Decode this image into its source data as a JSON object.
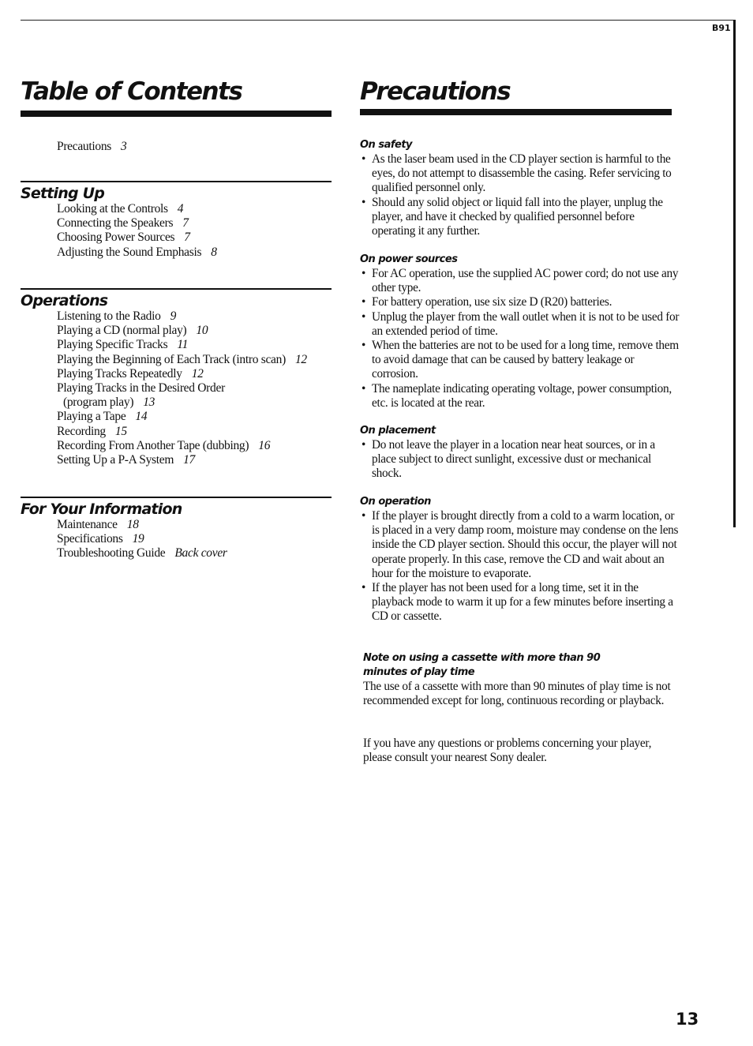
{
  "model_code": "B91",
  "toc": {
    "title": "Table of Contents",
    "intro": [
      {
        "label": "Precautions",
        "page": "3"
      }
    ],
    "sections": [
      {
        "title": "Setting Up",
        "items": [
          {
            "label": "Looking at the Controls",
            "page": "4"
          },
          {
            "label": "Connecting the Speakers",
            "page": "7"
          },
          {
            "label": "Choosing Power Sources",
            "page": "7"
          },
          {
            "label": "Adjusting the Sound Emphasis",
            "page": "8"
          }
        ]
      },
      {
        "title": "Operations",
        "items": [
          {
            "label": "Listening to the Radio",
            "page": "9"
          },
          {
            "label": "Playing a CD (normal play)",
            "page": "10"
          },
          {
            "label": "Playing Specific Tracks",
            "page": "11"
          },
          {
            "label": "Playing the Beginning of Each Track (intro scan)",
            "page": "12"
          },
          {
            "label": "Playing Tracks Repeatedly",
            "page": "12"
          },
          {
            "label": "Playing Tracks in the Desired Order",
            "page": ""
          },
          {
            "label": "(program play)",
            "page": "13"
          },
          {
            "label": "Playing a Tape",
            "page": "14"
          },
          {
            "label": "Recording",
            "page": "15"
          },
          {
            "label": "Recording From Another Tape (dubbing)",
            "page": "16"
          },
          {
            "label": "Setting Up a P-A System",
            "page": "17"
          }
        ]
      },
      {
        "title": "For Your Information",
        "items": [
          {
            "label": "Maintenance",
            "page": "18"
          },
          {
            "label": "Specifications",
            "page": "19"
          },
          {
            "label": "Troubleshooting Guide",
            "page": "Back cover"
          }
        ]
      }
    ]
  },
  "precautions": {
    "title": "Precautions",
    "safety": {
      "heading": "On safety",
      "bullets": [
        "As the laser beam used in the CD player section is harmful to the eyes, do not attempt to disassemble the casing. Refer servicing to qualified personnel only.",
        "Should any solid object or liquid fall into the player, unplug the player, and have it checked by qualified personnel before operating it any further."
      ]
    },
    "power": {
      "heading": "On power sources",
      "bullets": [
        "For AC operation, use the supplied AC power cord; do not use any other type.",
        "For battery operation, use six size D (R20) batteries.",
        "Unplug the player from the wall outlet when it is not to be used for an extended period of time.",
        "When the batteries are not to be used for a long time, remove them to avoid damage that can be caused by battery leakage or corrosion.",
        "The nameplate indicating operating voltage, power consumption, etc. is located at the rear."
      ]
    },
    "placement": {
      "heading": "On placement",
      "bullets": [
        "Do not leave the player in a location near heat sources, or in a place subject to direct sunlight, excessive dust or mechanical shock."
      ]
    },
    "operation": {
      "heading": "On operation",
      "bullets": [
        "If the player is brought directly from a cold to a warm location, or is placed in a very damp room, moisture may condense on the lens inside the CD player section. Should this occur, the player will not operate properly. In this case, remove the CD and wait about an hour for the moisture to evaporate.",
        "If the player has not been used for a long time, set it in the playback mode to warm it up for a few minutes before inserting a CD or cassette."
      ]
    },
    "cassette_note": {
      "heading": "Note on using a cassette with more than 90 minutes of play time",
      "body": "The use of a cassette with more than 90 minutes of play time is not recommended except for long, continuous recording or playback."
    },
    "closing": "If you have any questions or problems concerning your player, please consult your nearest Sony dealer."
  },
  "page_number": "13",
  "bullet_glyph": "•"
}
